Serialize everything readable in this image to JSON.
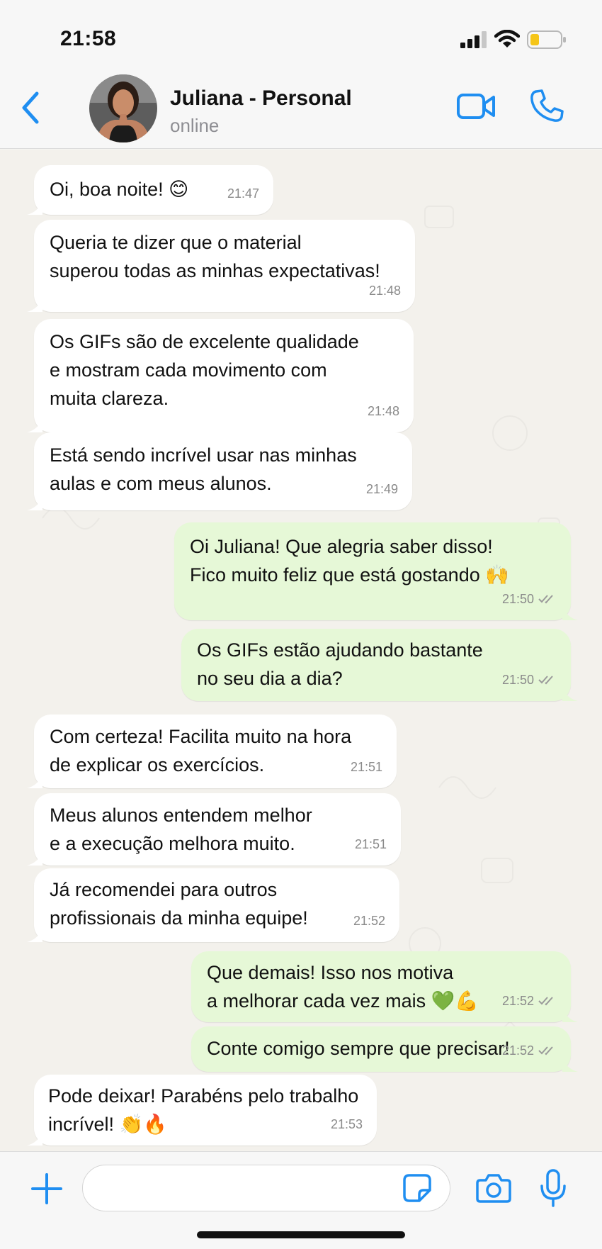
{
  "status_bar": {
    "time": "21:58"
  },
  "header": {
    "contact_name": "Juliana - Personal",
    "contact_status": "online"
  },
  "messages": [
    {
      "dir": "in",
      "text": "Oi, boa noite! 😊",
      "time": "21:47"
    },
    {
      "dir": "in",
      "text": "Queria te dizer que o material\nsuperou todas as minhas expectativas!",
      "time": "21:48"
    },
    {
      "dir": "in",
      "text": "Os GIFs são de excelente qualidade\ne mostram cada movimento com\nmuita clareza.",
      "time": "21:48"
    },
    {
      "dir": "in",
      "text": "Está sendo incrível usar nas minhas\naulas e com meus alunos.",
      "time": "21:49"
    },
    {
      "dir": "out",
      "text": "Oi Juliana! Que alegria saber disso!\nFico muito feliz que está gostando 🙌",
      "time": "21:50"
    },
    {
      "dir": "out",
      "text": "Os GIFs estão ajudando bastante\nno seu dia a dia?",
      "time": "21:50"
    },
    {
      "dir": "in",
      "text": "Com certeza! Facilita muito na hora\nde explicar os exercícios.",
      "time": "21:51"
    },
    {
      "dir": "in",
      "text": "Meus alunos entendem melhor\ne a execução melhora muito.",
      "time": "21:51"
    },
    {
      "dir": "in",
      "text": "Já recomendei para outros\nprofissionais da minha equipe!",
      "time": "21:52"
    },
    {
      "dir": "out",
      "text": "Que demais! Isso nos motiva\na melhorar cada vez mais 💚💪",
      "time": "21:52"
    },
    {
      "dir": "out",
      "text": "Conte comigo sempre que precisar!",
      "time": "21:52"
    },
    {
      "dir": "in",
      "text": "Pode deixar! Parabéns pelo trabalho\nincrível! 👏🔥",
      "time": "21:53"
    }
  ],
  "input": {
    "placeholder": ""
  },
  "colors": {
    "accent": "#1f8ef1",
    "outgoing_bubble": "#e6f8d7",
    "incoming_bubble": "#ffffff",
    "chat_background": "#f3f1ec"
  },
  "icons": [
    "back-chevron",
    "video-camera",
    "phone",
    "plus",
    "sticker",
    "camera",
    "microphone"
  ]
}
